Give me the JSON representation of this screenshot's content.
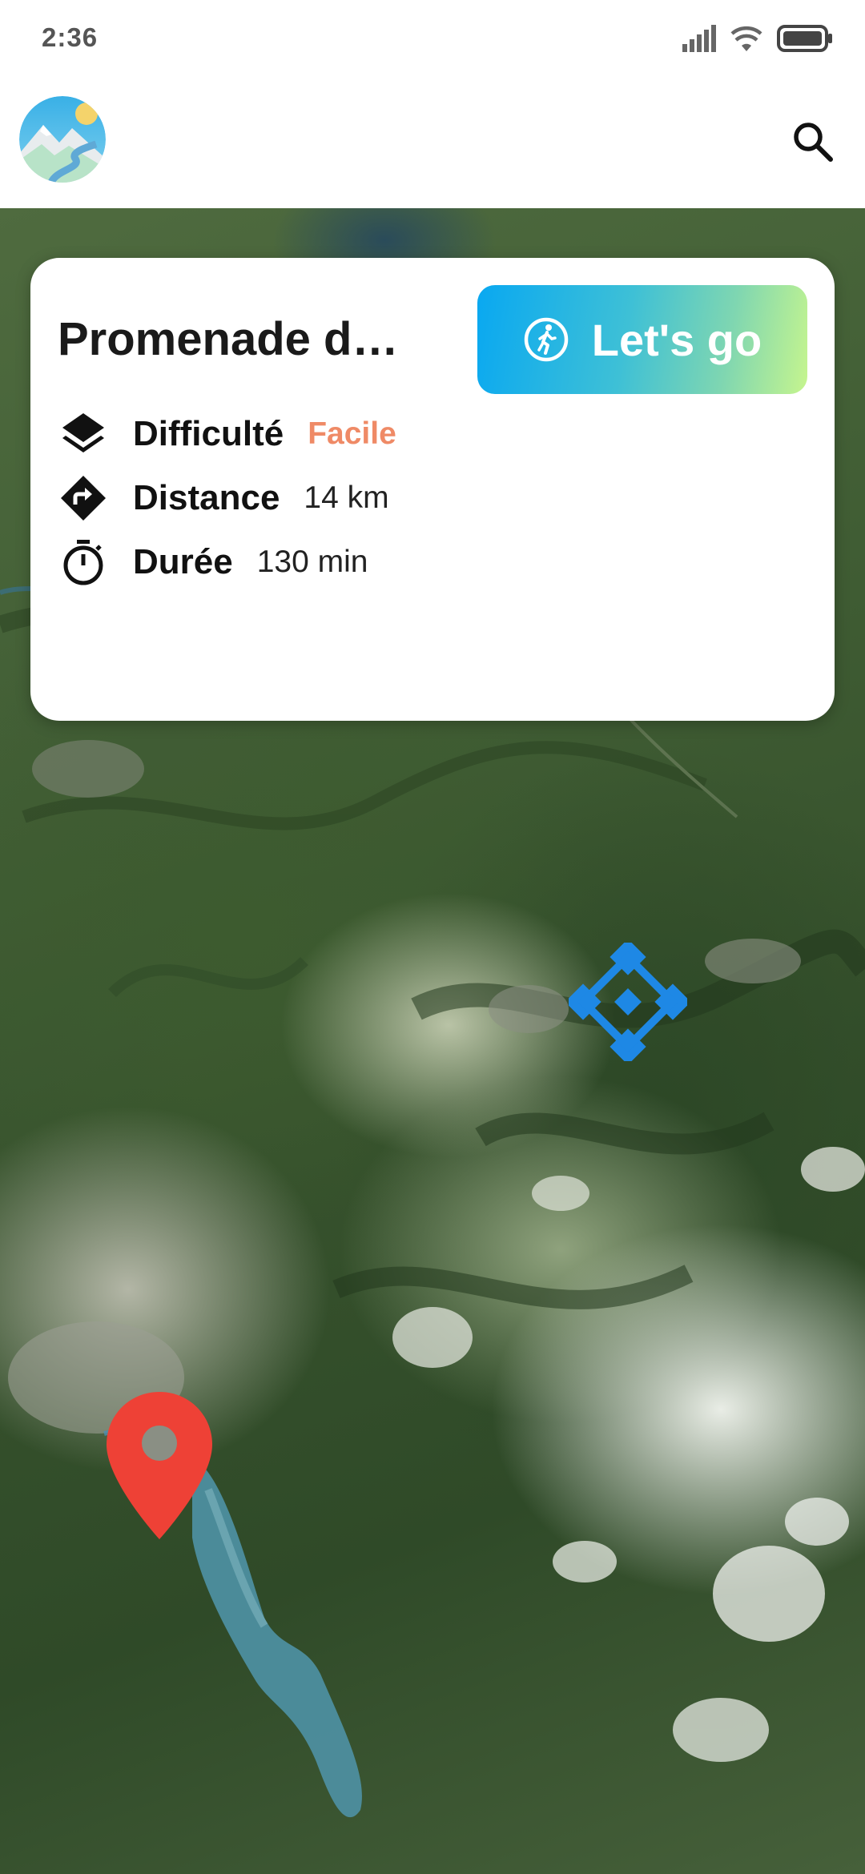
{
  "status_bar": {
    "time": "2:36",
    "icons": [
      "signal-icon",
      "wifi-icon",
      "battery-icon"
    ]
  },
  "header": {
    "avatar_icon": "mountain-logo",
    "search_icon": "search-icon"
  },
  "card": {
    "title": "Promenade d…",
    "go_button_label": "Let's go",
    "go_button_icon": "walking-icon",
    "rows": [
      {
        "icon": "layers-icon",
        "label": "Difficulté",
        "value": "Facile"
      },
      {
        "icon": "directions-icon",
        "label": "Distance",
        "value": "14 km"
      },
      {
        "icon": "timer-icon",
        "label": "Durée",
        "value": "130 min"
      }
    ]
  },
  "map": {
    "markers": [
      "route-start-icon",
      "location-pin-icon"
    ]
  },
  "colors": {
    "difficulty": "#ef8a66",
    "pin": "#ee4136",
    "route_marker": "#1e88e5",
    "button_gradient_start": "#09a8f1",
    "button_gradient_end": "#c6f58e"
  }
}
